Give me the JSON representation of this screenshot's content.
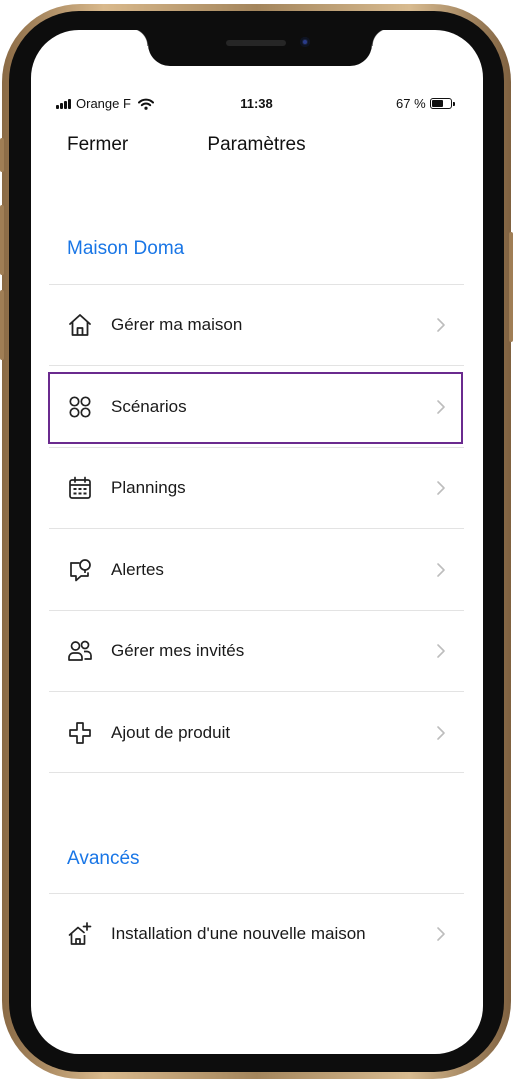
{
  "status_bar": {
    "carrier": "Orange F",
    "time": "11:38",
    "battery": "67 %"
  },
  "nav": {
    "close_label": "Fermer",
    "title": "Paramètres"
  },
  "sections": {
    "house": {
      "title": "Maison Doma",
      "items": [
        {
          "label": "Gérer ma maison",
          "icon": "home-icon"
        },
        {
          "label": "Scénarios",
          "icon": "scenarios-icon"
        },
        {
          "label": "Plannings",
          "icon": "calendar-icon"
        },
        {
          "label": "Alertes",
          "icon": "alert-bubble-icon"
        },
        {
          "label": "Gérer mes invités",
          "icon": "users-icon"
        },
        {
          "label": "Ajout de produit",
          "icon": "add-product-icon"
        }
      ]
    },
    "advanced": {
      "title": "Avancés",
      "items": [
        {
          "label": "Installation d'une nouvelle maison",
          "icon": "new-home-icon"
        }
      ]
    }
  },
  "colors": {
    "accent": "#1976e6",
    "highlight_border": "#6a2a8e"
  }
}
